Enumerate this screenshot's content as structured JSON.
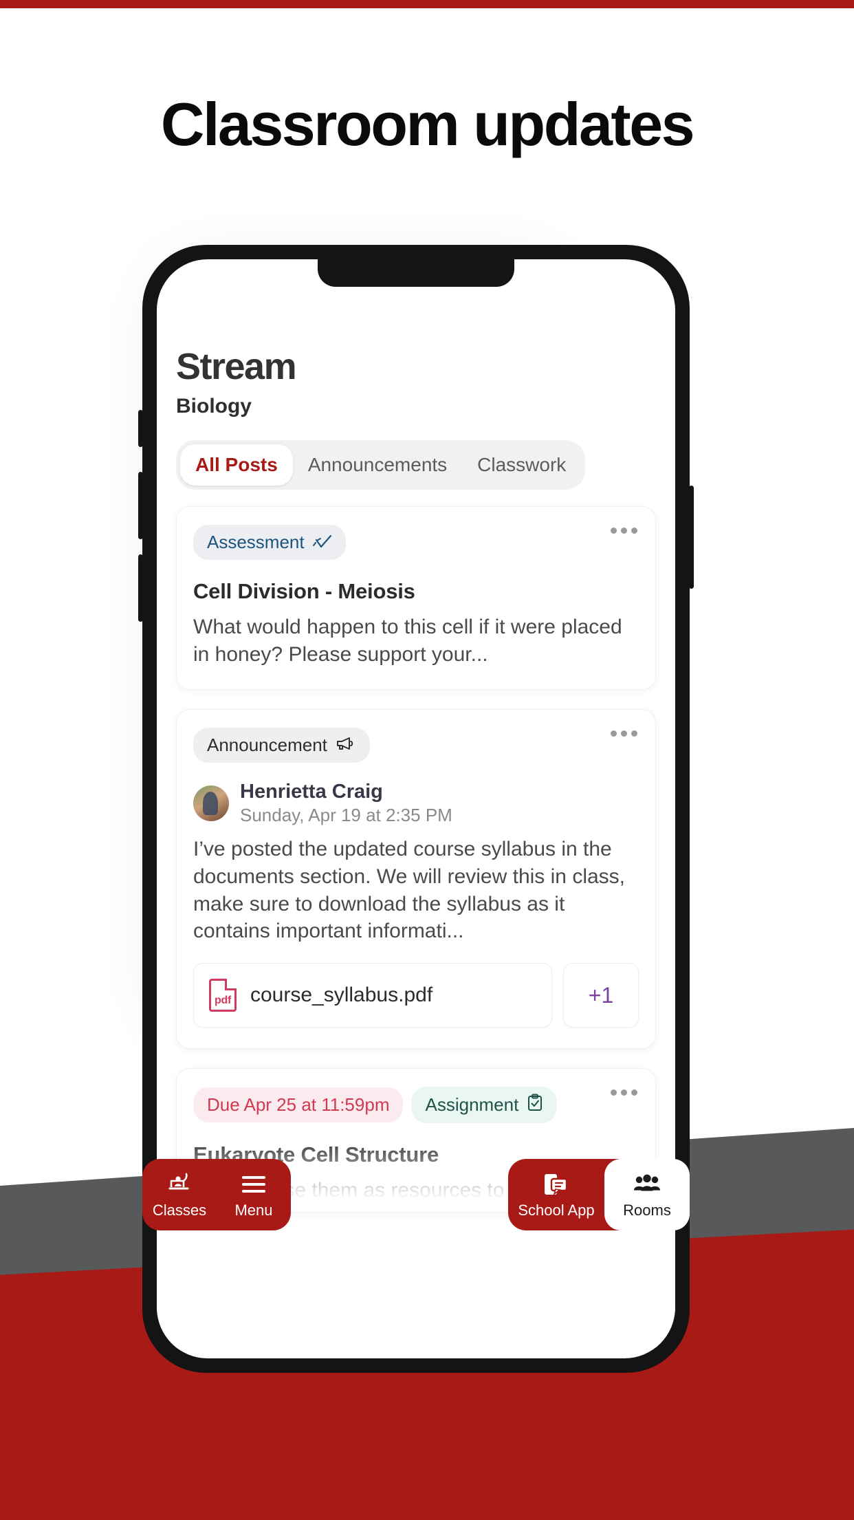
{
  "headline": "Classroom updates",
  "colors": {
    "brand_red": "#a81a16",
    "accent_blue": "#1c5580",
    "accent_teal": "#1f5248",
    "accent_pink": "#cf3a52",
    "accent_purple": "#7b3fa0",
    "band_grey": "#58595b"
  },
  "screen": {
    "title": "Stream",
    "subtitle": "Biology",
    "tabs": [
      {
        "label": "All Posts",
        "active": true
      },
      {
        "label": "Announcements",
        "active": false
      },
      {
        "label": "Classwork",
        "active": false
      }
    ],
    "posts": [
      {
        "badge": "Assessment",
        "badge_icon": "trend-chart-icon",
        "title": "Cell Division - Meiosis",
        "body": "What would happen to this cell if it were placed in honey? Please support your..."
      },
      {
        "badge": "Announcement",
        "badge_icon": "megaphone-icon",
        "author": "Henrietta Craig",
        "date": "Sunday, Apr 19 at 2:35 PM",
        "body": "I’ve posted the updated course syllabus in the documents section. We will review this in class, make sure to download the syllabus as it contains important informati...",
        "attachment": {
          "name": "course_syllabus.pdf",
          "icon": "pdf-file-icon",
          "more_label": "+1"
        }
      },
      {
        "due_badge": "Due Apr 25 at 11:59pm",
        "badge": "Assignment",
        "badge_icon": "clipboard-check-icon",
        "title": "Eukaryote Cell Structure",
        "body": "You can use them as resources to go to for help, for a project or an assignment. The"
      }
    ],
    "kebab_icon": "more-options-icon"
  },
  "bottom_nav": [
    {
      "label": "Classes",
      "icon": "lectern-presenter-icon",
      "active": false
    },
    {
      "label": "Menu",
      "icon": "hamburger-menu-icon",
      "active": false
    },
    {
      "label": "School App",
      "icon": "phone-chat-icon",
      "active": false
    },
    {
      "label": "Rooms",
      "icon": "people-group-icon",
      "active": true
    }
  ]
}
